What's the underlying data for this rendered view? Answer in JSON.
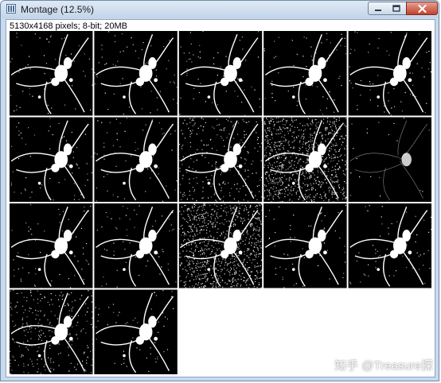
{
  "window": {
    "title": "Montage (12.5%)",
    "icon": "imagej-window-icon",
    "controls": {
      "minimize_icon": "minimize-icon",
      "maximize_icon": "maximize-icon",
      "close_icon": "close-icon"
    }
  },
  "image_info": "5130x4168 pixels; 8-bit; 20MB",
  "montage": {
    "columns": 5,
    "rows": 4,
    "panels": [
      {
        "variant": "binary"
      },
      {
        "variant": "binary"
      },
      {
        "variant": "binary"
      },
      {
        "variant": "binary"
      },
      {
        "variant": "binary"
      },
      {
        "variant": "binary"
      },
      {
        "variant": "binary"
      },
      {
        "variant": "noisy"
      },
      {
        "variant": "very-noisy"
      },
      {
        "variant": "sparse"
      },
      {
        "variant": "binary"
      },
      {
        "variant": "binary"
      },
      {
        "variant": "very-noisy"
      },
      {
        "variant": "binary"
      },
      {
        "variant": "binary"
      },
      {
        "variant": "noisy"
      },
      {
        "variant": "binary"
      },
      {
        "variant": "empty"
      },
      {
        "variant": "empty"
      },
      {
        "variant": "empty"
      }
    ]
  },
  "watermark": "知乎 @Treasure探",
  "colors": {
    "panel_background": "#000000",
    "foreground": "#ffffff",
    "window_frame": "#c9daee",
    "close_button": "#c2412c"
  }
}
